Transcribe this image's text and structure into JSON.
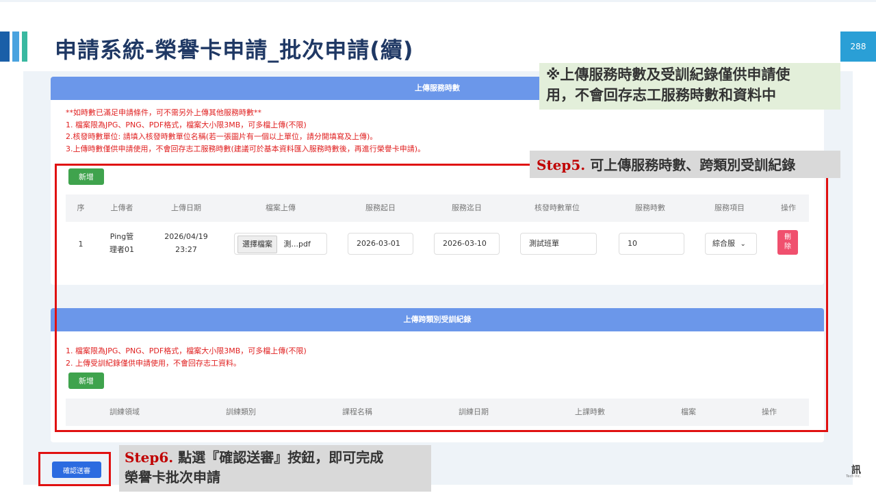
{
  "slide": {
    "title": "申請系統-榮譽卡申請_批次申請(續)",
    "page_number": "288",
    "logo_text": "訊",
    "logo_subtext": "Tech Inc."
  },
  "service_panel": {
    "header": "上傳服務時數",
    "notes": [
      "**如時數已滿足申請條件，可不需另外上傳其他服務時數**",
      "1. 檔案限為JPG、PNG、PDF格式，檔案大小限3MB，可多檔上傳(不限)",
      "2.核發時數單位: 請填入核發時數單位名稱(若一張圖片有一個以上單位，請分開填寫及上傳)。",
      "3.上傳時數僅供申請使用，不會回存志工服務時數(建議可於基本資料匯入服務時數後，再進行榮譽卡申請)。"
    ],
    "add_button": "新增",
    "columns": [
      "序",
      "上傳者",
      "上傳日期",
      "檔案上傳",
      "服務起日",
      "服務迄日",
      "核發時數單位",
      "服務時數",
      "服務項目",
      "操作"
    ],
    "row": {
      "seq": "1",
      "uploader_line1": "Ping管",
      "uploader_line2": "理者01",
      "upload_date": "2026/04/19",
      "upload_time": "23:27",
      "file_button": "選擇檔案",
      "file_name": "測...pdf",
      "start_date": "2026-03-01",
      "end_date": "2026-03-10",
      "unit": "測試班單",
      "hours": "10",
      "service_item": "綜合服",
      "delete_line1": "刪",
      "delete_line2": "除"
    }
  },
  "training_panel": {
    "header": "上傳跨類別受訓紀錄",
    "notes": [
      "1. 檔案限為JPG、PNG、PDF格式，檔案大小限3MB，可多檔上傳(不限)",
      "2. 上傳受訓紀錄僅供申請使用，不會回存志工資料。"
    ],
    "add_button": "新增",
    "columns": [
      "訓練領域",
      "訓練類別",
      "課程名稱",
      "訓練日期",
      "上課時數",
      "檔案",
      "操作"
    ]
  },
  "submit_button": "確認送審",
  "callouts": {
    "note": "※上傳服務時數及受訓紀錄僅供申請使用，不會回存志工服務時數和資料中",
    "note_line1": "※上傳服務時數及受訓紀錄僅供申請使",
    "note_line2": "用，不會回存志工服務時數和資料中",
    "step5_label": "Step5.",
    "step5_text": "可上傳服務時數、跨類別受訓紀錄",
    "step6_label": "Step6.",
    "step6_text_line1": "點選『確認送審』按鈕，即可完成",
    "step6_text_line2": "榮譽卡批次申請"
  },
  "colors": {
    "panel_header": "#6b97ea",
    "add_button": "#3fa34d",
    "delete_button": "#f0506e",
    "submit_button": "#2b6be0",
    "highlight_frame": "#e01010",
    "step_label": "#c00000"
  }
}
